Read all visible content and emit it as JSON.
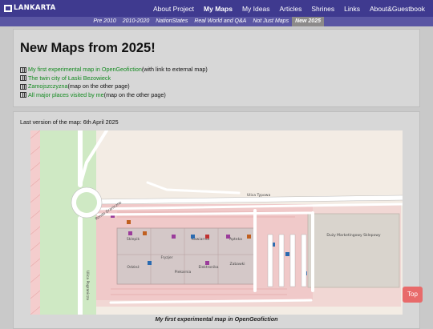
{
  "site": {
    "logo_text": "LANKARTA"
  },
  "nav": {
    "items": [
      {
        "label": "About Project",
        "active": false
      },
      {
        "label": "My Maps",
        "active": true
      },
      {
        "label": "My Ideas",
        "active": false
      },
      {
        "label": "Articles",
        "active": false
      },
      {
        "label": "Shrines",
        "active": false
      },
      {
        "label": "Links",
        "active": false
      },
      {
        "label": "About&Guestbook",
        "active": false
      }
    ]
  },
  "subnav": {
    "items": [
      {
        "label": "Pre 2010",
        "active": false
      },
      {
        "label": "2010-2020",
        "active": false
      },
      {
        "label": "NationStates",
        "active": false
      },
      {
        "label": "Real World and Q&A",
        "active": false
      },
      {
        "label": "Not Just Maps",
        "active": false
      },
      {
        "label": "New 2025",
        "active": true
      }
    ]
  },
  "content": {
    "heading": "New Maps from 2025!",
    "links": [
      {
        "link_text": "My first experimental map in OpenGeofiction",
        "note": " (with link to external map)"
      },
      {
        "link_text": "The twin city of Łaski Bezowieck",
        "note": ""
      },
      {
        "link_text": "Zamojszczyzna",
        "note": " (map on the other page)"
      },
      {
        "link_text": "All major places visited by me",
        "note": " (map on the other page)"
      }
    ],
    "last_version": "Last version of the map: 6th April 2025",
    "caption": "My first experimental map in OpenGeofiction",
    "colors": {
      "link": "#138a1f",
      "nav_bg": "#3f3a8f",
      "subnav_bg": "#5a56a3",
      "top_button": "#e86a6a"
    }
  },
  "map": {
    "street_east": "Ulica Typowa",
    "street_west": "Ulica Pogranicza",
    "roundabout_road": "Rondo Graniczne",
    "store_label": "Duży Marketingowy Sklepowy",
    "shop_labels": [
      "Sklepik",
      "Fryzjer",
      "Kawiarnia",
      "Apteka",
      "Odzież",
      "Piekarnia",
      "Elektronika",
      "Zabawki"
    ]
  },
  "top_button": {
    "label": "Top"
  }
}
